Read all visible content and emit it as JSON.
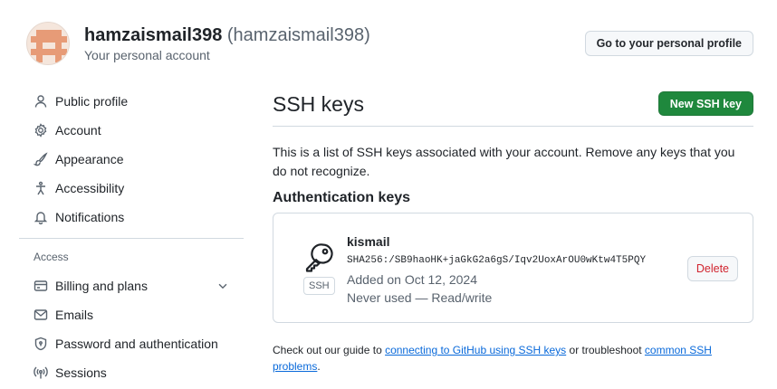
{
  "header": {
    "username": "hamzaismail398",
    "handle": "(hamzaismail398)",
    "subtitle": "Your personal account",
    "profile_button": "Go to your personal profile"
  },
  "sidebar": {
    "items": [
      {
        "label": "Public profile",
        "icon": "person-icon"
      },
      {
        "label": "Account",
        "icon": "gear-icon"
      },
      {
        "label": "Appearance",
        "icon": "paintbrush-icon"
      },
      {
        "label": "Accessibility",
        "icon": "accessibility-icon"
      },
      {
        "label": "Notifications",
        "icon": "bell-icon"
      }
    ],
    "access_title": "Access",
    "access_items": [
      {
        "label": "Billing and plans",
        "icon": "credit-card-icon"
      },
      {
        "label": "Emails",
        "icon": "mail-icon"
      },
      {
        "label": "Password and authentication",
        "icon": "shield-lock-icon"
      },
      {
        "label": "Sessions",
        "icon": "broadcast-icon"
      }
    ]
  },
  "main": {
    "title": "SSH keys",
    "new_button": "New SSH key",
    "description": "This is a list of SSH keys associated with your account. Remove any keys that you do not recognize.",
    "auth_title": "Authentication keys",
    "key": {
      "name": "kismail",
      "fingerprint": "SHA256:/SB9haoHK+jaGkG2a6gS/Iqv2UoxArOU0wKtw4T5PQY",
      "added": "Added on Oct 12, 2024",
      "usage": "Never used — Read/write",
      "badge": "SSH",
      "delete_button": "Delete"
    },
    "footer": {
      "text1": "Check out our guide to ",
      "link1": "connecting to GitHub using SSH keys",
      "text2": " or troubleshoot ",
      "link2": "common SSH problems",
      "text3": "."
    }
  },
  "colors": {
    "accent_green": "#1f883d",
    "link_blue": "#0969da",
    "danger_red": "#d1242f",
    "avatar_bg": "#f5e6dc",
    "avatar_fg": "#e79b77"
  }
}
